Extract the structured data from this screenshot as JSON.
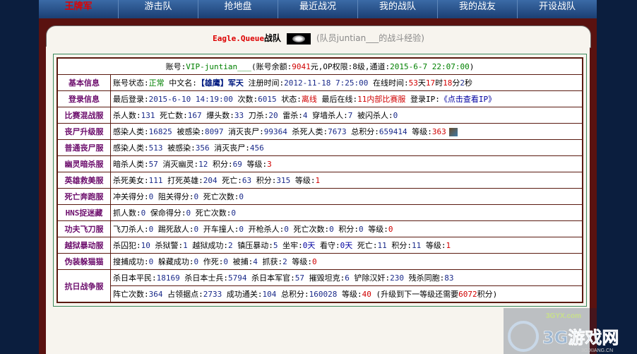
{
  "nav": {
    "items": [
      "王牌军",
      "游击队",
      "抢地盘",
      "最近战况",
      "我的战队",
      "我的战友",
      "开设战队"
    ]
  },
  "tab": {
    "team_name": "Eagle.Queue",
    "team_suffix": "战队",
    "paren_text": "(队员juntian___的战斗经验)"
  },
  "header": {
    "p1": "账号:",
    "account": "VIP-juntian___",
    "p2": "(账号余额:",
    "balance": "9041",
    "p3": "元,OP权限:",
    "op": "8级",
    "p4": ",通道:",
    "date": "2015-6-7 22:07:00",
    "p5": ")"
  },
  "rows": [
    {
      "label": "基本信息",
      "parts": [
        [
          "账号状态:",
          ""
        ],
        [
          "正常",
          "green"
        ],
        [
          " 中文名:",
          ""
        ],
        [
          "【雄鹰】军天",
          "dblue"
        ],
        [
          " 注册时间:",
          ""
        ],
        [
          "2012-11-18 7:25:00",
          "navy"
        ],
        [
          " 在线时间:",
          ""
        ],
        [
          "53",
          "red"
        ],
        [
          "天",
          ""
        ],
        [
          "17",
          "red"
        ],
        [
          "时",
          ""
        ],
        [
          "18",
          "red"
        ],
        [
          "分",
          ""
        ],
        [
          "2",
          "navy"
        ],
        [
          "秒",
          ""
        ]
      ]
    },
    {
      "label": "登录信息",
      "parts": [
        [
          "最后登录:",
          ""
        ],
        [
          "2015-6-10 14:19:00",
          "navy"
        ],
        [
          " 次数:",
          ""
        ],
        [
          "6015",
          "navy"
        ],
        [
          " 状态:",
          ""
        ],
        [
          "离线",
          "red"
        ],
        [
          " 最后在线:",
          ""
        ],
        [
          "11内部比赛服",
          "red"
        ],
        [
          " 登录IP:",
          ""
        ],
        [
          "《点击查看IP》",
          "blue"
        ]
      ]
    },
    {
      "label": "比赛混战服",
      "parts": [
        [
          "杀人数:",
          ""
        ],
        [
          "131",
          "navy"
        ],
        [
          " 死亡数:",
          ""
        ],
        [
          "167",
          "navy"
        ],
        [
          " 爆头数:",
          ""
        ],
        [
          "33",
          "navy"
        ],
        [
          " 刀杀:",
          ""
        ],
        [
          "20",
          "navy"
        ],
        [
          " 雷杀:",
          ""
        ],
        [
          "4",
          "navy"
        ],
        [
          " 穿墙杀人:",
          ""
        ],
        [
          "7",
          "navy"
        ],
        [
          " 被闪杀人:",
          ""
        ],
        [
          "0",
          "navy"
        ]
      ]
    },
    {
      "label": "丧尸升级服",
      "parts": [
        [
          "感染人类:",
          ""
        ],
        [
          "16825",
          "navy"
        ],
        [
          " 被感染:",
          ""
        ],
        [
          "8097",
          "navy"
        ],
        [
          " 消灭丧尸:",
          ""
        ],
        [
          "99364",
          "navy"
        ],
        [
          " 杀死人类:",
          ""
        ],
        [
          "7673",
          "navy"
        ],
        [
          " 总积分:",
          ""
        ],
        [
          "659414",
          "navy"
        ],
        [
          " 等级:",
          ""
        ],
        [
          "363",
          "red"
        ]
      ],
      "badge": true
    },
    {
      "label": "普通丧尸服",
      "parts": [
        [
          "感染人类:",
          ""
        ],
        [
          "513",
          "navy"
        ],
        [
          " 被感染:",
          ""
        ],
        [
          "356",
          "navy"
        ],
        [
          " 消灭丧尸:",
          ""
        ],
        [
          "456",
          "navy"
        ]
      ]
    },
    {
      "label": "幽灵暗杀服",
      "parts": [
        [
          "暗杀人类:",
          ""
        ],
        [
          "57",
          "navy"
        ],
        [
          " 消灭幽灵:",
          ""
        ],
        [
          "12",
          "navy"
        ],
        [
          " 积分:",
          ""
        ],
        [
          "69",
          "navy"
        ],
        [
          " 等级:",
          ""
        ],
        [
          "3",
          "red"
        ]
      ]
    },
    {
      "label": "英雄救美服",
      "parts": [
        [
          "杀死美女:",
          ""
        ],
        [
          "111",
          "navy"
        ],
        [
          " 打死英雄:",
          ""
        ],
        [
          "204",
          "navy"
        ],
        [
          " 死亡:",
          ""
        ],
        [
          "63",
          "navy"
        ],
        [
          " 积分:",
          ""
        ],
        [
          "315",
          "navy"
        ],
        [
          " 等级:",
          ""
        ],
        [
          "1",
          "red"
        ]
      ]
    },
    {
      "label": "死亡奔跑服",
      "parts": [
        [
          "冲关得分:",
          ""
        ],
        [
          "0",
          "navy"
        ],
        [
          " 阻关得分:",
          ""
        ],
        [
          "0",
          "navy"
        ],
        [
          " 死亡次数:",
          ""
        ],
        [
          "0",
          "navy"
        ]
      ]
    },
    {
      "label": "HNS捉迷藏",
      "parts": [
        [
          "抓人数:",
          ""
        ],
        [
          "0",
          "navy"
        ],
        [
          " 保命得分:",
          ""
        ],
        [
          "0",
          "navy"
        ],
        [
          " 死亡次数:",
          ""
        ],
        [
          "0",
          "navy"
        ]
      ]
    },
    {
      "label": "功夫飞刀服",
      "parts": [
        [
          "飞刀杀人:",
          ""
        ],
        [
          "0",
          "navy"
        ],
        [
          " 踢死敌人:",
          ""
        ],
        [
          "0",
          "navy"
        ],
        [
          " 开车撞人:",
          ""
        ],
        [
          "0",
          "navy"
        ],
        [
          " 开枪杀人:",
          ""
        ],
        [
          "0",
          "navy"
        ],
        [
          " 死亡次数:",
          ""
        ],
        [
          "0",
          "navy"
        ],
        [
          " 积分:",
          ""
        ],
        [
          "0",
          "navy"
        ],
        [
          " 等级:",
          ""
        ],
        [
          "0",
          "red"
        ]
      ]
    },
    {
      "label": "越狱暴动服",
      "parts": [
        [
          "杀囚犯:",
          ""
        ],
        [
          "10",
          "navy"
        ],
        [
          " 杀狱警:",
          ""
        ],
        [
          "1",
          "navy"
        ],
        [
          " 越狱成功:",
          ""
        ],
        [
          "2",
          "navy"
        ],
        [
          " 镇压暴动:",
          ""
        ],
        [
          "5",
          "navy"
        ],
        [
          " 坐牢:",
          ""
        ],
        [
          "0天",
          "blue"
        ],
        [
          " 看守:",
          ""
        ],
        [
          "0天",
          "blue"
        ],
        [
          " 死亡:",
          ""
        ],
        [
          "11",
          "navy"
        ],
        [
          " 积分:",
          ""
        ],
        [
          "11",
          "navy"
        ],
        [
          " 等级:",
          ""
        ],
        [
          "1",
          "red"
        ]
      ]
    },
    {
      "label": "伪装躲猫猫",
      "parts": [
        [
          "搜捕成功:",
          ""
        ],
        [
          "0",
          "navy"
        ],
        [
          " 躲藏成功:",
          ""
        ],
        [
          "0",
          "navy"
        ],
        [
          " 作死:",
          ""
        ],
        [
          "0",
          "navy"
        ],
        [
          " 被捕:",
          ""
        ],
        [
          "4",
          "navy"
        ],
        [
          " 抓获:",
          ""
        ],
        [
          "2",
          "navy"
        ],
        [
          " 等级:",
          ""
        ],
        [
          "0",
          "red"
        ]
      ]
    }
  ],
  "war": {
    "label": "抗日战争服",
    "line1": [
      [
        "杀日本平民:",
        ""
      ],
      [
        "18169",
        "navy"
      ],
      [
        " 杀日本士兵:",
        ""
      ],
      [
        "5794",
        "navy"
      ],
      [
        " 杀日本军官:",
        ""
      ],
      [
        "57",
        "navy"
      ],
      [
        " 摧毁坦克:",
        ""
      ],
      [
        "6",
        "navy"
      ],
      [
        " 铲除汉奸:",
        ""
      ],
      [
        "230",
        "navy"
      ],
      [
        " 残杀同胞:",
        ""
      ],
      [
        "83",
        "navy"
      ]
    ],
    "line2": [
      [
        "阵亡次数:",
        ""
      ],
      [
        "364",
        "navy"
      ],
      [
        " 占领据点:",
        ""
      ],
      [
        "2733",
        "navy"
      ],
      [
        " 成功通关:",
        ""
      ],
      [
        "104",
        "navy"
      ],
      [
        " 总积分:",
        ""
      ],
      [
        "160028",
        "navy"
      ],
      [
        " 等级:",
        ""
      ],
      [
        "40",
        "red"
      ],
      [
        " (升级到下一等级还需要",
        ""
      ],
      [
        "6072",
        "red"
      ],
      [
        "积分)",
        ""
      ]
    ]
  },
  "watermark": {
    "url": "3GYX.com",
    "brand": "3G游戏网",
    "site": "3G.XIANG.CN"
  },
  "colors": {
    "label": "#6c0d6c",
    "border": "#5a1a10",
    "frame": "#5a1210",
    "header_bg": "#fffcd0",
    "nav_active": "#e00000"
  }
}
